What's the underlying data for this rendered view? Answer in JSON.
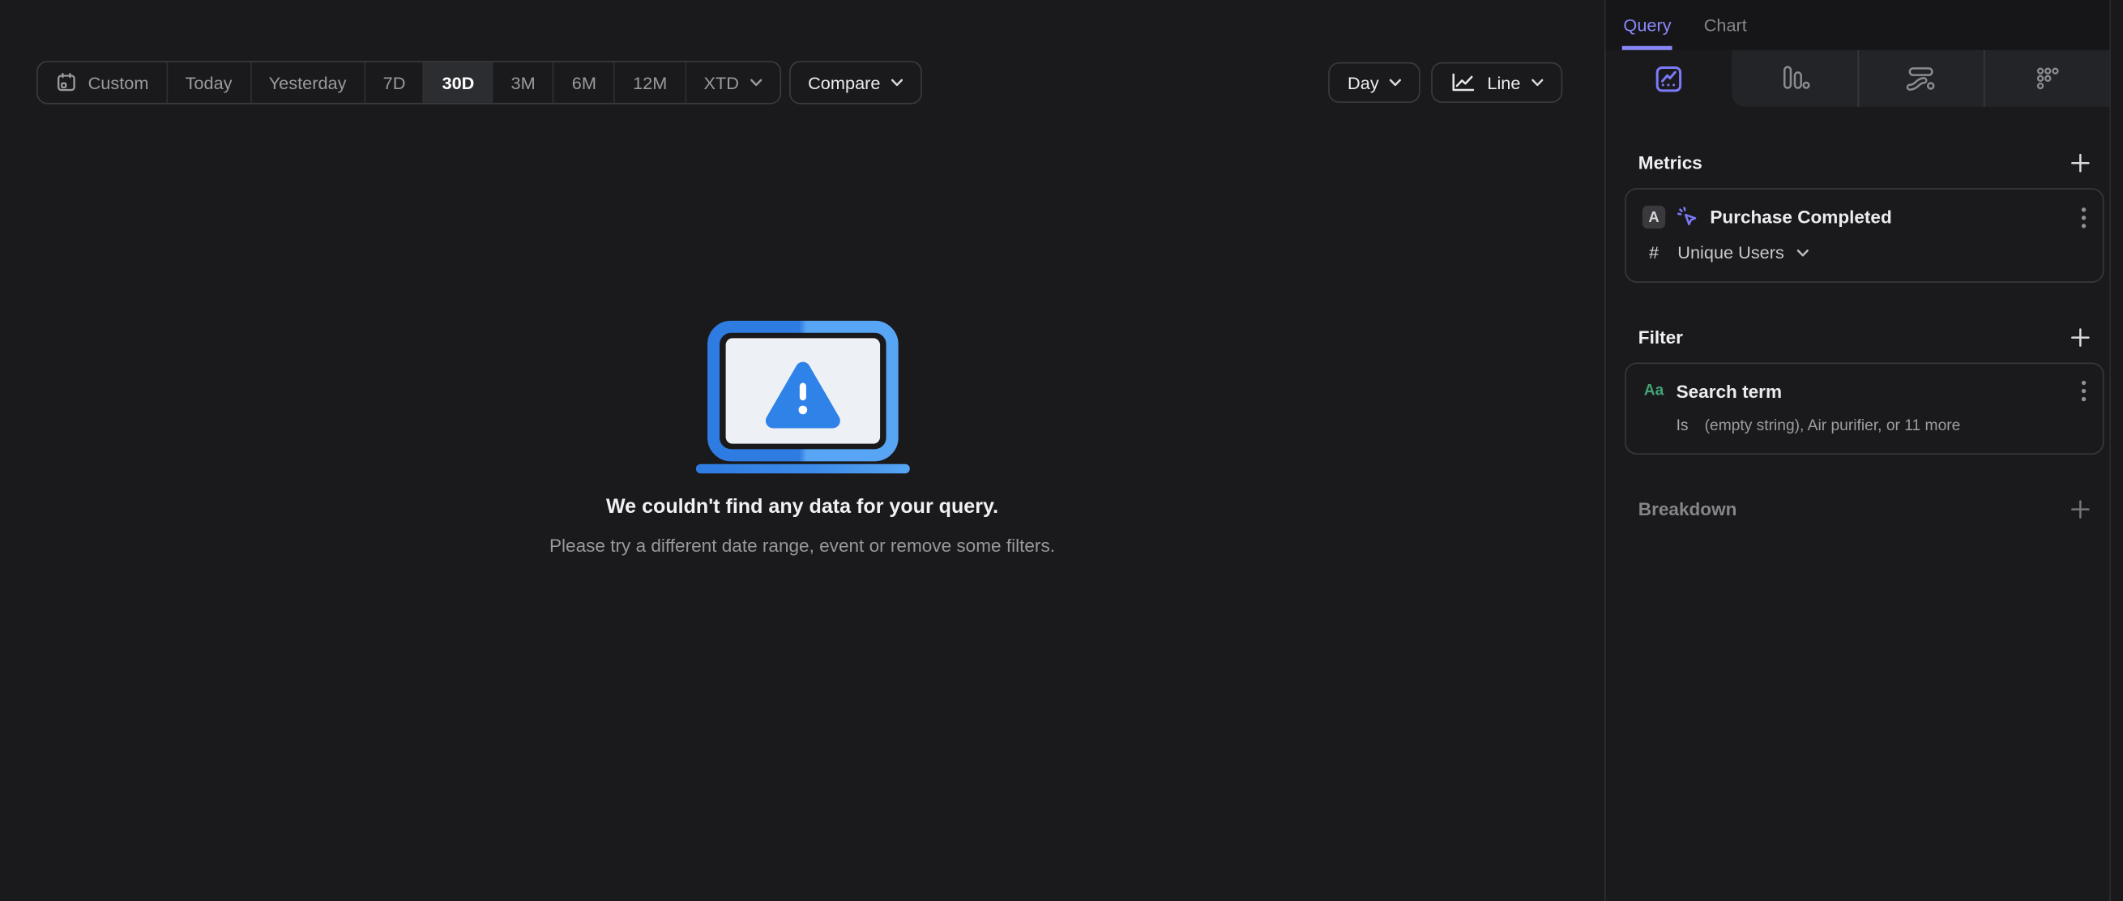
{
  "toolbar": {
    "date_range": {
      "custom": "Custom",
      "presets": [
        "Today",
        "Yesterday",
        "7D",
        "30D",
        "3M",
        "6M",
        "12M"
      ],
      "selected": "30D",
      "to_date": "XTD"
    },
    "compare": "Compare"
  },
  "view_controls": {
    "granularity": "Day",
    "chart_type": "Line"
  },
  "empty_state": {
    "title": "We couldn't find any data for your query.",
    "subtitle": "Please try a different date range, event or remove some filters."
  },
  "sidebar": {
    "tabs": {
      "query": "Query",
      "chart": "Chart",
      "active": "Query"
    },
    "metrics": {
      "title": "Metrics",
      "event_letter": "A",
      "event_name": "Purchase Completed",
      "aggregation_prefix": "#",
      "aggregation": "Unique Users"
    },
    "filter": {
      "title": "Filter",
      "property_type": "Aa",
      "property_name": "Search term",
      "operator": "Is",
      "values_summary": "(empty string), Air purifier, or 11 more"
    },
    "breakdown": {
      "title": "Breakdown"
    }
  },
  "colors": {
    "accent_purple": "#8887f8",
    "property_green": "#42a374",
    "illustration_blue_dark": "#2e7ce2",
    "illustration_blue_light": "#57a5f4",
    "selected_segment_bg": "#2c2d31"
  }
}
